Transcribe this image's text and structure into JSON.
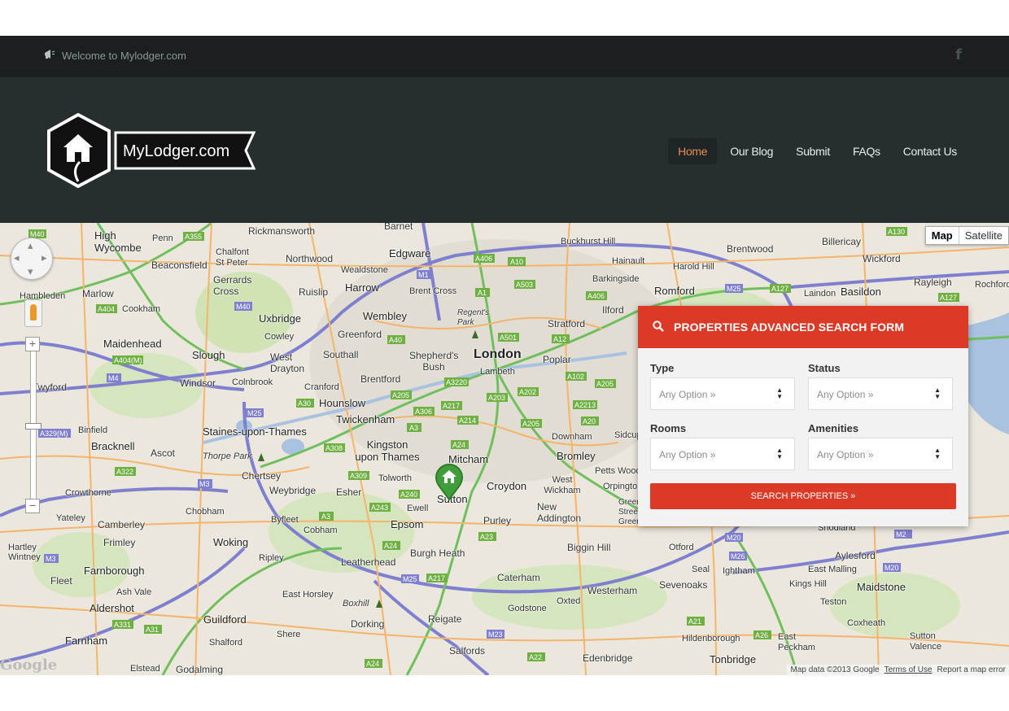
{
  "topbar": {
    "welcome": "Welcome to Mylodger.com",
    "facebook_glyph": "f"
  },
  "logo": {
    "text": "MyLodger.com"
  },
  "nav": {
    "items": [
      "Home",
      "Our Blog",
      "Submit",
      "FAQs",
      "Contact Us"
    ],
    "active": "Home"
  },
  "map": {
    "map_type": {
      "map": "Map",
      "satellite": "Satellite"
    },
    "google": "Google",
    "attribution": {
      "data": "Map data ©2013 Google",
      "terms": "Terms of Use",
      "report": "Report a map error"
    },
    "places": {
      "london": "London",
      "croydon": "Croydon",
      "wembley": "Wembley",
      "harrow": "Harrow",
      "edgware": "Edgware",
      "barnet": "Barnet",
      "romford": "Romford",
      "basildon": "Basildon",
      "brentwood": "Brentwood",
      "billericay": "Billericay",
      "wickford": "Wickford",
      "rayleigh": "Rayleigh",
      "ilford": "Ilford",
      "stratford": "Stratford",
      "poplar": "Poplar",
      "lambeth": "Lambeth",
      "brentford": "Brentford",
      "hounslow": "Hounslow",
      "twickenham": "Twickenham",
      "kingston": "Kingston upon Thames",
      "mitcham": "Mitcham",
      "sutton": "Sutton",
      "epsom": "Epsom",
      "slough": "Slough",
      "uxbridge": "Uxbridge",
      "maidenhead": "Maidenhead",
      "windsor": "Windsor",
      "staines": "Staines-upon-Thames",
      "bracknell": "Bracknell",
      "woking": "Woking",
      "guildford": "Guildford",
      "farnborough": "Farnborough",
      "aldershot": "Aldershot",
      "farnham": "Farnham",
      "reigate": "Reigate",
      "dorking": "Dorking",
      "caterham": "Caterham",
      "sevenoaks": "Sevenoaks",
      "tonbridge": "Tonbridge",
      "maidstone": "Maidstone",
      "bromley": "Bromley",
      "downham": "Downham",
      "purley": "Purley",
      "high_wycombe": "High Wycombe",
      "beaconsfield": "Beaconsfield",
      "rickmansworth": "Rickmansworth",
      "northwood": "Northwood",
      "watford_area": "Wealdstone",
      "ruislip": "Ruislip",
      "ealing": "Greenford",
      "southall": "Southall",
      "west_drayton": "West Drayton",
      "shepherds_bush": "Shepherd's Bush",
      "chertsey": "Chertsey",
      "weybridge": "Weybridge",
      "esher": "Esher",
      "tolworth": "Tolworth",
      "leatherhead": "Leatherhead",
      "burgh_heath": "Burgh Heath",
      "biggin_hill": "Biggin Hill",
      "edenbridge": "Edenbridge",
      "oxted": "Oxted",
      "godstone": "Godstone",
      "westerham": "Westerham",
      "east_grinstead_area": "Salfords",
      "crawley_area": "Godalming",
      "elstead": "Elstead",
      "shalford": "Shalford",
      "shere": "Shere",
      "ripley": "Ripley",
      "cobham": "Cobham",
      "byfleet": "Byfleet",
      "chobham": "Chobham",
      "camberley": "Camberley",
      "frimley": "Frimley",
      "fleet": "Fleet",
      "ascot": "Ascot",
      "binfield": "Binfield",
      "twyford": "Twyford",
      "marlow": "Marlow",
      "cookham": "Cookham",
      "hambleden": "Hambleden",
      "penn": "Penn",
      "chalfont": "Chalfont St Peter",
      "gerrards": "Gerrards Cross",
      "hainault": "Hainault",
      "buckhurst": "Buckhurst Hill",
      "barkingside": "Barkingside",
      "harold_hill": "Harold Hill",
      "laindon": "Laindon",
      "aylesford": "Aylesford",
      "east_malling": "East Malling",
      "kings_hill": "Kings Hill",
      "teston": "Teston",
      "coxheath": "Coxheath",
      "otford": "Otford",
      "seal": "Seal",
      "ightham": "Ightham",
      "hildenborough": "Hildenborough",
      "east_peckham": "East Peckham",
      "sutton_valence": "Sutton Valence",
      "new_addington": "New Addington",
      "west_wickham": "West Wickham",
      "petts_wood": "Petts Wood",
      "orpington": "Orpington",
      "sidcup": "Sidcup",
      "ewell": "Ewell",
      "east_horsley": "East Horsley",
      "ash_vale": "Ash Vale",
      "crowthorne": "Crowthorne",
      "yateley": "Yateley",
      "hartley_wintney": "Hartley Wintney",
      "cowley": "Cowley",
      "colnbrook": "Colnbrook",
      "cranford": "Cranford",
      "thorpe_park": "Thorpe Park",
      "boxhill": "Boxhill",
      "regents_park": "Regent's Park",
      "brent_cross": "Brent Cross",
      "snodland": "Snodland",
      "rochford": "Rochford",
      "westerham2": "Green Street Green",
      "river": "River Thames"
    }
  },
  "search_form": {
    "title": "PROPERTIES ADVANCED SEARCH FORM",
    "fields": [
      {
        "label": "Type",
        "value": "Any Option »"
      },
      {
        "label": "Status",
        "value": "Any Option »"
      },
      {
        "label": "Rooms",
        "value": "Any Option »"
      },
      {
        "label": "Amenities",
        "value": "Any Option »"
      }
    ],
    "button": "SEARCH PROPERTIES »"
  },
  "colors": {
    "accent": "#db3b26",
    "nav_active": "#e58f54",
    "topbar": "#1b1f20",
    "header": "#272e2f"
  }
}
